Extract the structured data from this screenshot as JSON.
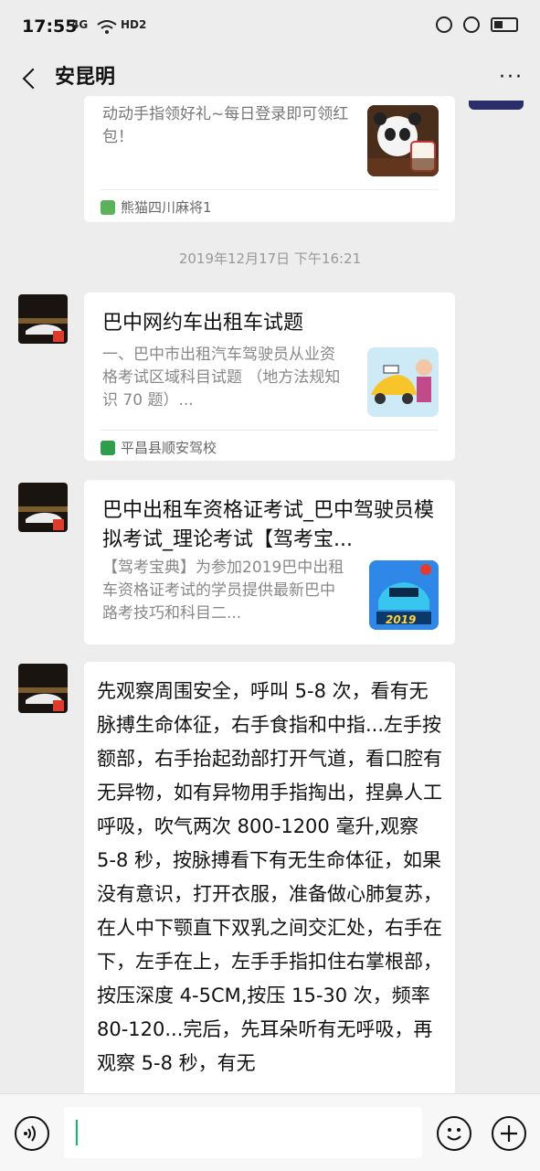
{
  "status_bar": {
    "time": "17:55",
    "signal": "4G",
    "network": "HD2"
  },
  "header": {
    "title": "安昆明",
    "more_label": "···"
  },
  "messages": [
    {
      "type": "link_card",
      "desc": "动动手指领好礼~每日登录即可领红包！",
      "source": "熊猫四川麻将1"
    },
    {
      "type": "timestamp",
      "text": "2019年12月17日 下午16:21"
    },
    {
      "type": "link_card",
      "title": "巴中网约车出租车试题",
      "desc": "一、巴中市出租汽车驾驶员从业资格考试区域科目试题 （地方法规知识  70 题）...",
      "source": "平昌县顺安驾校"
    },
    {
      "type": "link_card",
      "title": "巴中出租车资格证考试_巴中驾驶员模拟考试_理论考试【驾考宝...",
      "desc": "【驾考宝典】为参加2019巴中出租车资格证考试的学员提供最新巴中路考技巧和科目二...",
      "thumb_label": "2019"
    },
    {
      "type": "text",
      "text": "先观察周围安全，呼叫 5-8 次，看有无脉搏生命体征，右手食指和中指...左手按额部，右手抬起劲部打开气道，看口腔有无异物，如有异物用手指掏出，捏鼻人工呼吸，吹气两次 800-1200 毫升,观察 5-8 秒，按脉搏看下有无生命体征，如果没有意识，打开衣服，准备做心肺复苏，在人中下颚直下双乳之间交汇处，右手在下，左手在上，左手手指扣住右掌根部，按压深度 4-5CM,按压 15-30 次，频率 80-120...完后，先耳朵听有无呼吸，再观察 5-8 秒，有无"
    }
  ],
  "input_bar": {
    "value": ""
  },
  "colors": {
    "background": "#ededed",
    "card": "#ffffff",
    "accent": "#07c160"
  }
}
